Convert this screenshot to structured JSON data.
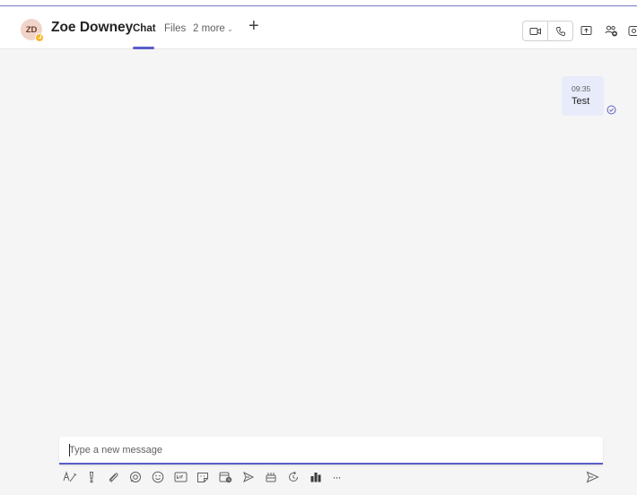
{
  "header": {
    "avatar_initials": "ZD",
    "contact_name": "Zoe Downey",
    "tabs": [
      {
        "label": "Chat",
        "active": true
      },
      {
        "label": "Files",
        "active": false
      },
      {
        "label": "2 more",
        "active": false
      }
    ],
    "add_tab_symbol": "+",
    "presence_status": "away",
    "presence_color": "#f8b62b",
    "icons": [
      "video-call-icon",
      "audio-call-icon",
      "share-screen-icon",
      "add-people-icon",
      "more-apps-icon"
    ]
  },
  "messages": [
    {
      "time": "09:35",
      "text": "Test",
      "status_icon": "read-receipt-icon",
      "outgoing": true
    }
  ],
  "compose": {
    "placeholder": "Type a new message",
    "value": "",
    "toolbar_icons": [
      "format-icon",
      "important-icon",
      "attach-icon",
      "loop-icon",
      "emoji-icon",
      "gif-icon",
      "sticker-icon",
      "schedule-meeting-icon",
      "stream-icon",
      "praise-icon",
      "updates-icon",
      "viva-icon",
      "more-options-icon"
    ],
    "more_symbol": "···",
    "send_icon": "send-icon"
  },
  "colors": {
    "accent": "#5b5fc7",
    "bubble": "#e8ebfa",
    "background": "#f5f5f5"
  }
}
